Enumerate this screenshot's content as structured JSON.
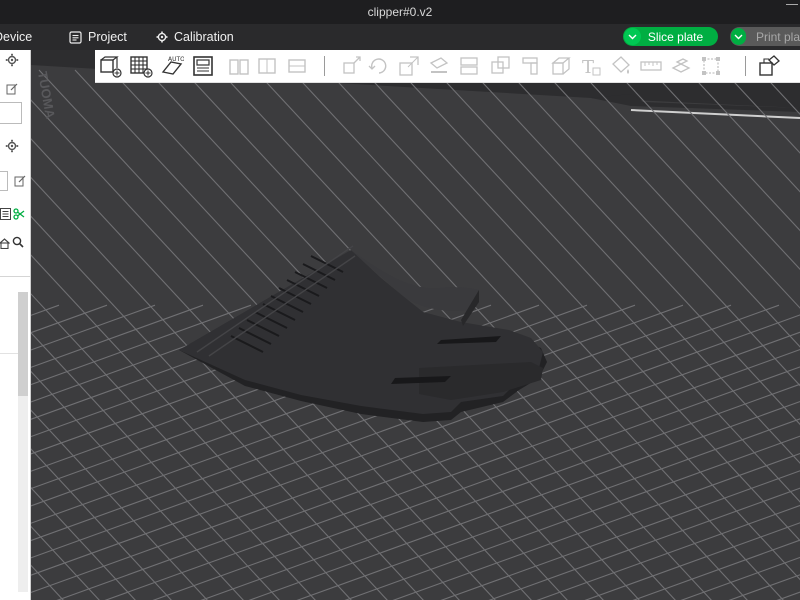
{
  "window": {
    "title": "clipper#0.v2"
  },
  "nav": {
    "device": "Device",
    "project": "Project",
    "calibration": "Calibration",
    "slice_plate": "Slice plate",
    "print_plate": "Print plate"
  },
  "icons": {
    "toolbar": [
      "add-object-icon",
      "arrange-grid-icon",
      "auto-orient-icon",
      "plate-settings-icon",
      "split-objects-icon",
      "split-parts-icon",
      "layer-icon",
      "move-icon",
      "rotate-icon",
      "scale-icon",
      "lay-on-face-icon",
      "cut-icon",
      "mesh-boolean-icon",
      "support-paint-icon",
      "seam-paint-icon",
      "text-shape-icon",
      "color-paint-icon",
      "measure-icon",
      "assembly-icon",
      "hollow-icon",
      "assembly-view-icon"
    ],
    "sidebar": [
      "gear-icon",
      "edit-icon",
      "gear-icon",
      "edit-icon",
      "list-icon",
      "scissors-icon",
      "home-icon",
      "search-icon"
    ]
  },
  "colors": {
    "accent": "#00ae42",
    "plate": "#3a3a3c",
    "grid": "#6f6f72",
    "model": "#2c2c2e"
  }
}
